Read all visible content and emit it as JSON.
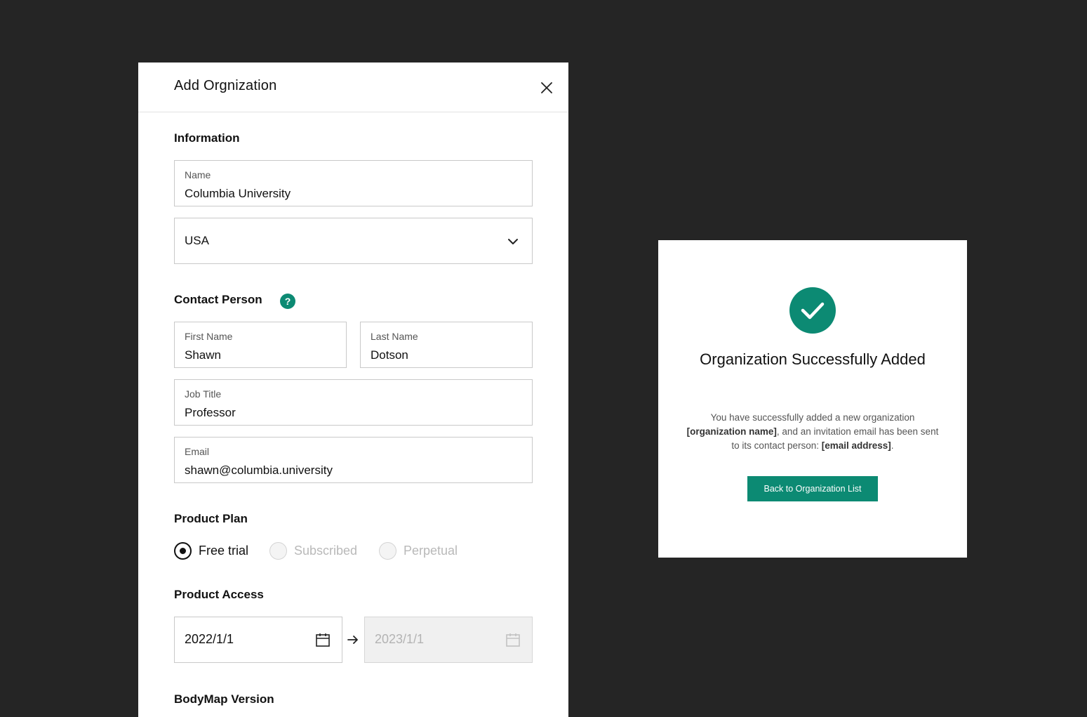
{
  "add_org_panel": {
    "title": "Add Orgnization",
    "information": {
      "heading": "Information",
      "name_label": "Name",
      "name_value": "Columbia University",
      "country_value": "USA"
    },
    "contact": {
      "heading": "Contact Person",
      "help_glyph": "?",
      "first_name_label": "First Name",
      "first_name_value": "Shawn",
      "last_name_label": "Last Name",
      "last_name_value": "Dotson",
      "job_title_label": "Job Title",
      "job_title_value": "Professor",
      "email_label": "Email",
      "email_value": "shawn@columbia.university"
    },
    "product_plan": {
      "heading": "Product Plan",
      "options": [
        {
          "label": "Free trial",
          "selected": true
        },
        {
          "label": "Subscribed",
          "selected": false
        },
        {
          "label": "Perpetual",
          "selected": false
        }
      ]
    },
    "product_access": {
      "heading": "Product Access",
      "start_date": "2022/1/1",
      "end_date": "2023/1/1"
    },
    "bodymap": {
      "heading": "BodyMap Version"
    }
  },
  "success_dialog": {
    "title": "Organization Successfully Added",
    "message_part1": "You have successfully added a new organization ",
    "message_bold1": "[organization name]",
    "message_part2": ", and an invitation email has been sent to its contact person: ",
    "message_bold2": "[email address]",
    "message_part3": ".",
    "button_label": "Back to Organization List"
  },
  "colors": {
    "accent": "#0c8a73",
    "background": "#252525"
  }
}
